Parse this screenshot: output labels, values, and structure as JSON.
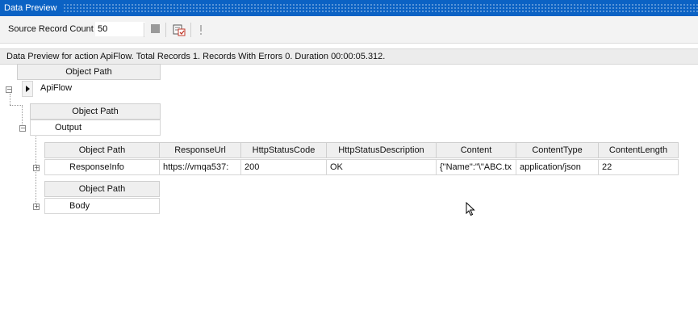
{
  "window": {
    "title": "Data Preview"
  },
  "toolbar": {
    "record_count_label": "Source Record Count",
    "record_count_value": "50",
    "icons": [
      "stop-icon",
      "export-icon",
      "warning-icon"
    ]
  },
  "status": {
    "text": "Data Preview for action ApiFlow. Total Records 1. Records With Errors 0. Duration 00:00:05.312."
  },
  "grid": {
    "level1": {
      "header": "Object Path",
      "value": "ApiFlow"
    },
    "level2": {
      "header": "Object Path",
      "value": "Output"
    },
    "level3": {
      "headers": [
        "Object Path",
        "ResponseUrl",
        "HttpStatusCode",
        "HttpStatusDescription",
        "Content",
        "ContentType",
        "ContentLength"
      ],
      "row": [
        "ResponseInfo",
        "https://vmqa537:",
        "200",
        "OK",
        "{\"Name\":\"\\\"ABC.tx",
        "application/json",
        "22"
      ]
    },
    "level4": {
      "header": "Object Path",
      "value": "Body"
    }
  },
  "colors": {
    "titlebar": "#0b62c4",
    "header_bg": "#efefef",
    "status_bg": "#ececec"
  }
}
